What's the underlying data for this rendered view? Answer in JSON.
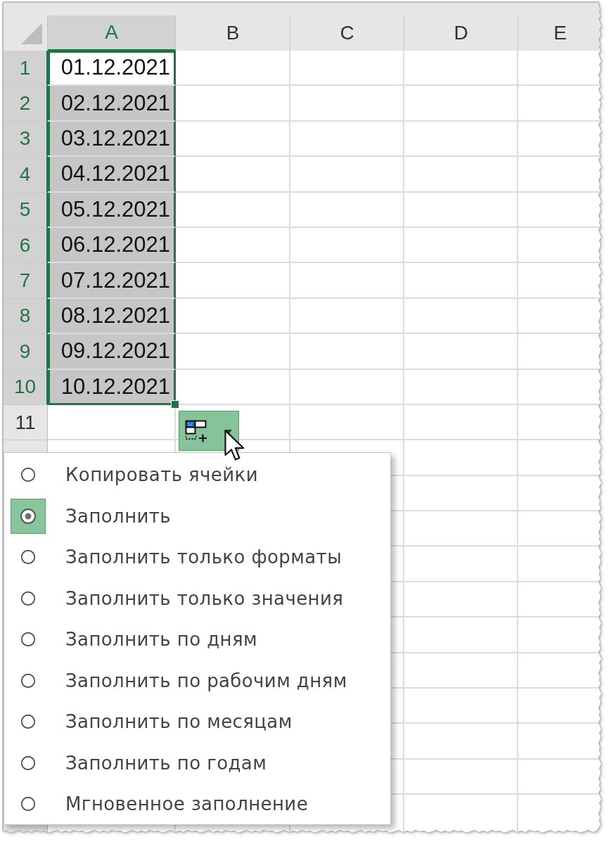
{
  "sheet": {
    "columns": [
      {
        "label": "A",
        "selected": true
      },
      {
        "label": "B",
        "selected": false
      },
      {
        "label": "C",
        "selected": false
      },
      {
        "label": "D",
        "selected": false
      },
      {
        "label": "E",
        "selected": false
      }
    ],
    "rows": [
      {
        "label": "1",
        "selected": true,
        "cells": [
          {
            "value": "01.12.2021",
            "selected": true,
            "active": true
          }
        ]
      },
      {
        "label": "2",
        "selected": true,
        "cells": [
          {
            "value": "02.12.2021",
            "selected": true,
            "active": false
          }
        ]
      },
      {
        "label": "3",
        "selected": true,
        "cells": [
          {
            "value": "03.12.2021",
            "selected": true,
            "active": false
          }
        ]
      },
      {
        "label": "4",
        "selected": true,
        "cells": [
          {
            "value": "04.12.2021",
            "selected": true,
            "active": false
          }
        ]
      },
      {
        "label": "5",
        "selected": true,
        "cells": [
          {
            "value": "05.12.2021",
            "selected": true,
            "active": false
          }
        ]
      },
      {
        "label": "6",
        "selected": true,
        "cells": [
          {
            "value": "06.12.2021",
            "selected": true,
            "active": false
          }
        ]
      },
      {
        "label": "7",
        "selected": true,
        "cells": [
          {
            "value": "07.12.2021",
            "selected": true,
            "active": false
          }
        ]
      },
      {
        "label": "8",
        "selected": true,
        "cells": [
          {
            "value": "08.12.2021",
            "selected": true,
            "active": false
          }
        ]
      },
      {
        "label": "9",
        "selected": true,
        "cells": [
          {
            "value": "09.12.2021",
            "selected": true,
            "active": false
          }
        ]
      },
      {
        "label": "10",
        "selected": true,
        "cells": [
          {
            "value": "10.12.2021",
            "selected": true,
            "active": false
          }
        ]
      },
      {
        "label": "11",
        "selected": false
      }
    ]
  },
  "autofill_button": {
    "expanded": true
  },
  "autofill_menu": {
    "items": [
      {
        "label": "Копировать ячейки",
        "selected": false
      },
      {
        "label": "Заполнить",
        "selected": true
      },
      {
        "label": "Заполнить только форматы",
        "selected": false
      },
      {
        "label": "Заполнить только значения",
        "selected": false
      },
      {
        "label": "Заполнить по дням",
        "selected": false
      },
      {
        "label": "Заполнить по рабочим дням",
        "selected": false
      },
      {
        "label": "Заполнить по месяцам",
        "selected": false
      },
      {
        "label": "Заполнить по годам",
        "selected": false
      },
      {
        "label": "Мгновенное заполнение",
        "selected": false
      }
    ]
  }
}
